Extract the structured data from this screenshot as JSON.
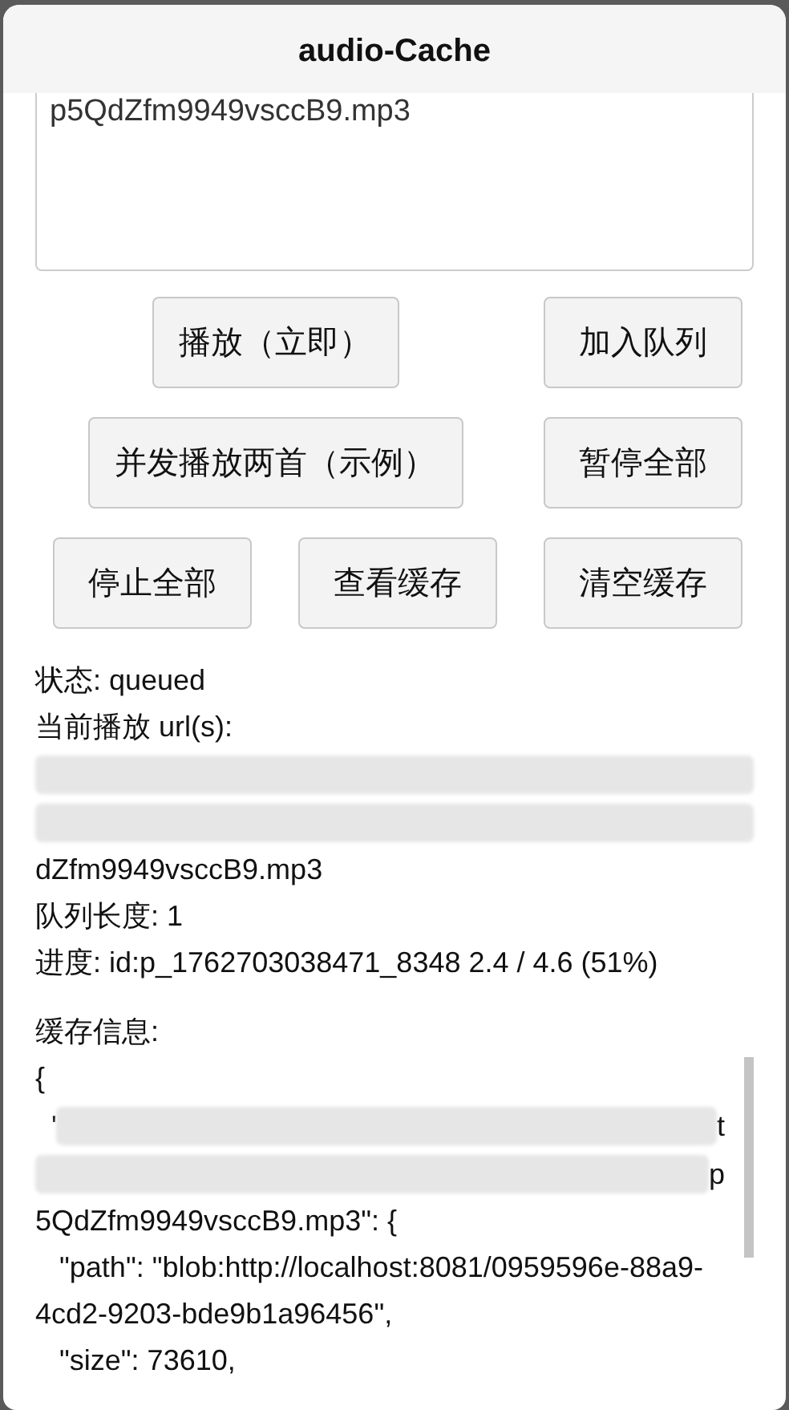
{
  "window": {
    "title": "audio-Cache"
  },
  "url_input": {
    "value": "p5QdZfm9949vsccB9.mp3"
  },
  "button_rows": [
    {
      "buttons": [
        {
          "label": "播放（立即）",
          "wide": true
        },
        {
          "label": "加入队列",
          "wide": false
        }
      ]
    },
    {
      "buttons": [
        {
          "label": "并发播放两首（示例）",
          "wide": true
        },
        {
          "label": "暂停全部",
          "wide": false
        }
      ]
    },
    {
      "buttons": [
        {
          "label": "停止全部",
          "wide": false
        },
        {
          "label": "查看缓存",
          "wide": false
        },
        {
          "label": "清空缓存",
          "wide": false
        }
      ]
    }
  ],
  "status_lines": [
    {
      "kind": "text",
      "text": "状态: queued"
    },
    {
      "kind": "text",
      "text": "当前播放 url(s):"
    },
    {
      "kind": "redacted"
    },
    {
      "kind": "redacted"
    },
    {
      "kind": "text",
      "text": "dZfm9949vsccB9.mp3"
    },
    {
      "kind": "text",
      "text": "队列长度: 1"
    },
    {
      "kind": "text",
      "text": "进度: id:p_1762703038471_8348 2.4 / 4.6 (51%)"
    }
  ],
  "cache_info": {
    "title": "缓存信息:",
    "lines": [
      {
        "kind": "text",
        "text": "{"
      },
      {
        "kind": "redacted",
        "prefix": "'",
        "suffix": "t"
      },
      {
        "kind": "redacted",
        "suffix": "p"
      },
      {
        "kind": "text",
        "text": "5QdZfm9949vsccB9.mp3\": {"
      },
      {
        "kind": "text",
        "text": "   \"path\": \"blob:http://localhost:8081/0959596e-88a9-4cd2-9203-bde9b1a96456\","
      },
      {
        "kind": "text",
        "text": "   \"size\": 73610,"
      }
    ]
  }
}
